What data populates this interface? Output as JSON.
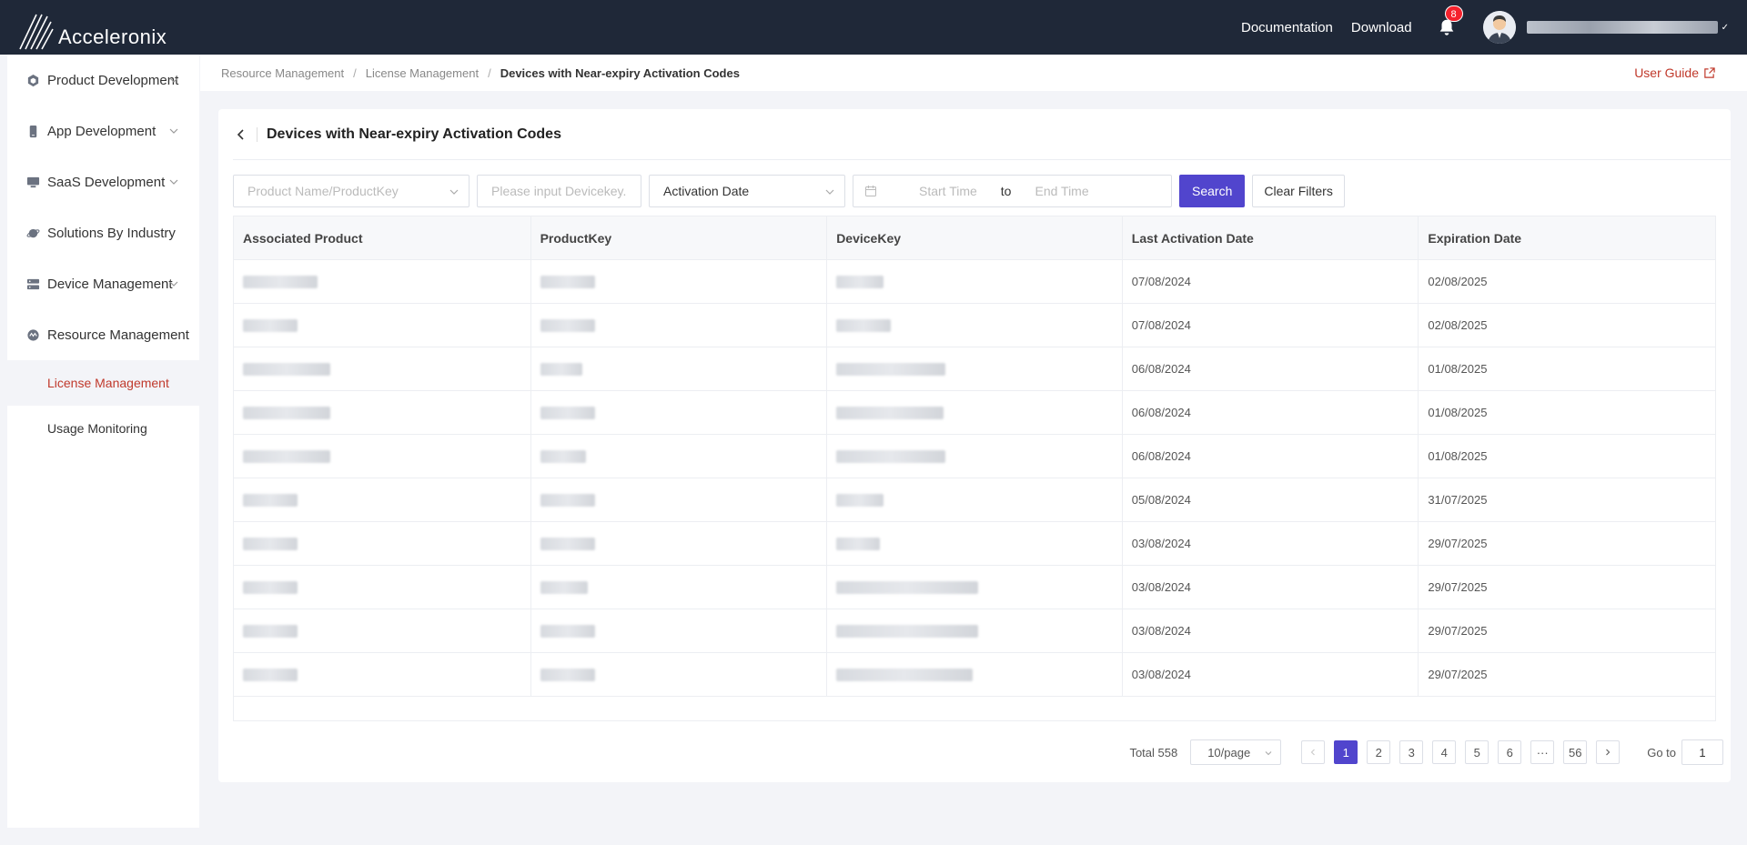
{
  "header": {
    "brand": "Acceleronix",
    "links": [
      "Documentation",
      "Download"
    ],
    "notification_count": "8"
  },
  "sidebar": {
    "items": [
      {
        "label": "Product Development",
        "icon": "cube-icon"
      },
      {
        "label": "App Development",
        "icon": "phone-icon"
      },
      {
        "label": "SaaS Development",
        "icon": "monitor-icon"
      },
      {
        "label": "Solutions By Industry",
        "icon": "planet-icon"
      },
      {
        "label": "Device Management",
        "icon": "server-icon"
      },
      {
        "label": "Resource Management",
        "icon": "gear-icon"
      }
    ],
    "subitems": [
      {
        "label": "License Management",
        "active": true
      },
      {
        "label": "Usage Monitoring",
        "active": false
      }
    ]
  },
  "breadcrumb": [
    "Resource Management",
    "License Management",
    "Devices with Near-expiry Activation Codes"
  ],
  "user_guide": "User Guide",
  "page_title": "Devices with Near-expiry Activation Codes",
  "filters": {
    "product_placeholder": "Product Name/ProductKey",
    "devicekey_placeholder": "Please input Devicekey.",
    "date_type": "Activation Date",
    "start_placeholder": "Start Time",
    "to": "to",
    "end_placeholder": "End Time",
    "search_label": "Search",
    "clear_label": "Clear Filters"
  },
  "table": {
    "columns": [
      "Associated Product",
      "ProductKey",
      "DeviceKey",
      "Last Activation Date",
      "Expiration Date"
    ],
    "rows": [
      {
        "last_activation": "07/08/2024",
        "expiration": "02/08/2025"
      },
      {
        "last_activation": "07/08/2024",
        "expiration": "02/08/2025"
      },
      {
        "last_activation": "06/08/2024",
        "expiration": "01/08/2025"
      },
      {
        "last_activation": "06/08/2024",
        "expiration": "01/08/2025"
      },
      {
        "last_activation": "06/08/2024",
        "expiration": "01/08/2025"
      },
      {
        "last_activation": "05/08/2024",
        "expiration": "31/07/2025"
      },
      {
        "last_activation": "03/08/2024",
        "expiration": "29/07/2025"
      },
      {
        "last_activation": "03/08/2024",
        "expiration": "29/07/2025"
      },
      {
        "last_activation": "03/08/2024",
        "expiration": "29/07/2025"
      },
      {
        "last_activation": "03/08/2024",
        "expiration": "29/07/2025"
      }
    ]
  },
  "pagination": {
    "total_label": "Total 558",
    "page_size": "10/page",
    "pages": [
      "1",
      "2",
      "3",
      "4",
      "5",
      "6",
      "···",
      "56"
    ],
    "current": "1",
    "goto_label": "Go to",
    "goto_value": "1"
  },
  "colors": {
    "topbar": "#1f2838",
    "accent": "#5145cd",
    "active_link": "#c0392b"
  }
}
